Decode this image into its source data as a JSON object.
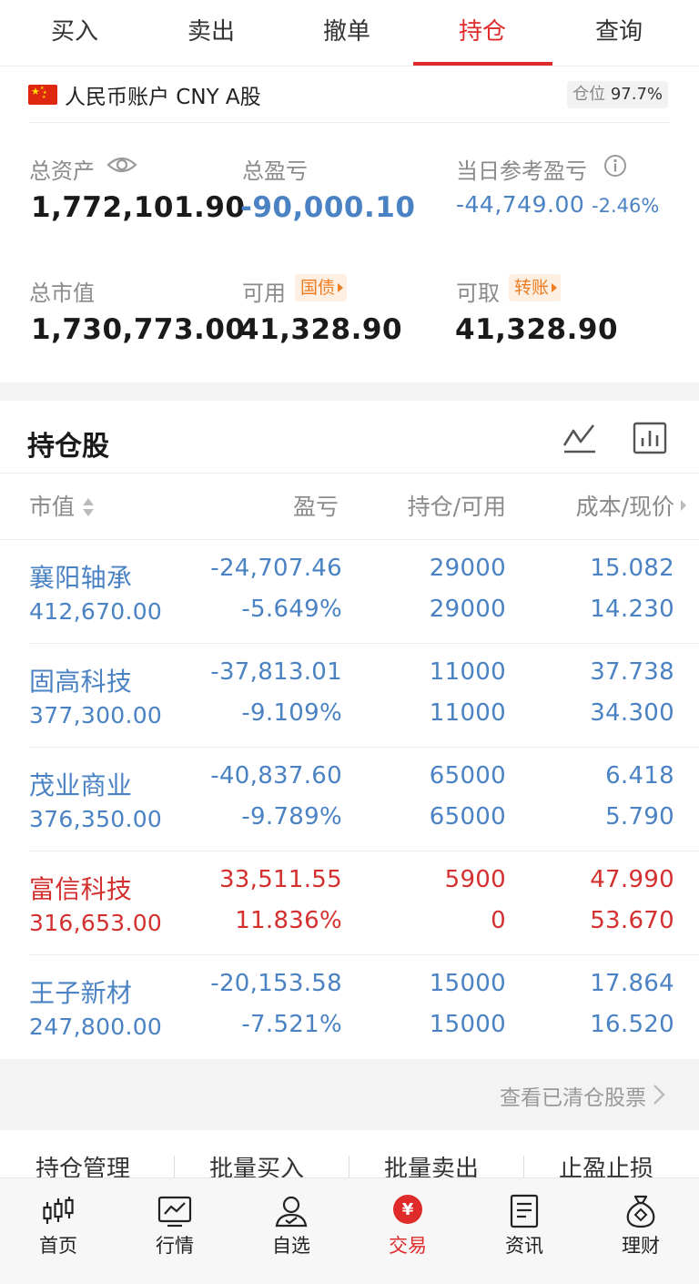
{
  "tabs": [
    {
      "label": "买入"
    },
    {
      "label": "卖出"
    },
    {
      "label": "撤单"
    },
    {
      "label": "持仓",
      "active": true
    },
    {
      "label": "查询"
    }
  ],
  "account": {
    "name": "人民币账户 CNY A股",
    "position_label": "仓位",
    "position_value": "97.7%",
    "flag": "cn-flag"
  },
  "summary": {
    "total_assets": {
      "label": "总资产",
      "value": "1,772,101.90"
    },
    "total_pl": {
      "label": "总盈亏",
      "value": "-90,000.10"
    },
    "daily_pl": {
      "label": "当日参考盈亏",
      "value": "-44,749.00",
      "pct": "-2.46%"
    },
    "market_value": {
      "label": "总市值",
      "value": "1,730,773.00"
    },
    "available": {
      "label": "可用",
      "tag": "国债",
      "value": "41,328.90"
    },
    "withdrawable": {
      "label": "可取",
      "tag": "转账",
      "value": "41,328.90"
    }
  },
  "holdings": {
    "title": "持仓股",
    "columns": {
      "mv": "市值",
      "pl": "盈亏",
      "hold": "持仓/可用",
      "cost": "成本/现价"
    },
    "rows": [
      {
        "name": "襄阳轴承",
        "mv": "412,670.00",
        "pl": "-24,707.46",
        "pl_pct": "-5.649%",
        "hold": "29000",
        "avail": "29000",
        "cost": "15.082",
        "price": "14.230",
        "trend": "down"
      },
      {
        "name": "固高科技",
        "mv": "377,300.00",
        "pl": "-37,813.01",
        "pl_pct": "-9.109%",
        "hold": "11000",
        "avail": "11000",
        "cost": "37.738",
        "price": "34.300",
        "trend": "down"
      },
      {
        "name": "茂业商业",
        "mv": "376,350.00",
        "pl": "-40,837.60",
        "pl_pct": "-9.789%",
        "hold": "65000",
        "avail": "65000",
        "cost": "6.418",
        "price": "5.790",
        "trend": "down"
      },
      {
        "name": "富信科技",
        "mv": "316,653.00",
        "pl": "33,511.55",
        "pl_pct": "11.836%",
        "hold": "5900",
        "avail": "0",
        "cost": "47.990",
        "price": "53.670",
        "trend": "up"
      },
      {
        "name": "王子新材",
        "mv": "247,800.00",
        "pl": "-20,153.58",
        "pl_pct": "-7.521%",
        "hold": "15000",
        "avail": "15000",
        "cost": "17.864",
        "price": "16.520",
        "trend": "down"
      }
    ],
    "cleared_link": "查看已清仓股票"
  },
  "actions": [
    {
      "label": "持仓管理"
    },
    {
      "label": "批量买入"
    },
    {
      "label": "批量卖出"
    },
    {
      "label": "止盈止损"
    }
  ],
  "nav": [
    {
      "label": "首页",
      "icon": "candlestick-icon"
    },
    {
      "label": "行情",
      "icon": "market-chart-icon"
    },
    {
      "label": "自选",
      "icon": "user-star-icon"
    },
    {
      "label": "交易",
      "icon": "yuan-icon",
      "active": true
    },
    {
      "label": "资讯",
      "icon": "document-icon"
    },
    {
      "label": "理财",
      "icon": "money-bag-icon"
    }
  ],
  "colors": {
    "accent": "#e02b2b",
    "down": "#4a82c4",
    "up": "#d53030",
    "tag": "#ef7d20"
  }
}
